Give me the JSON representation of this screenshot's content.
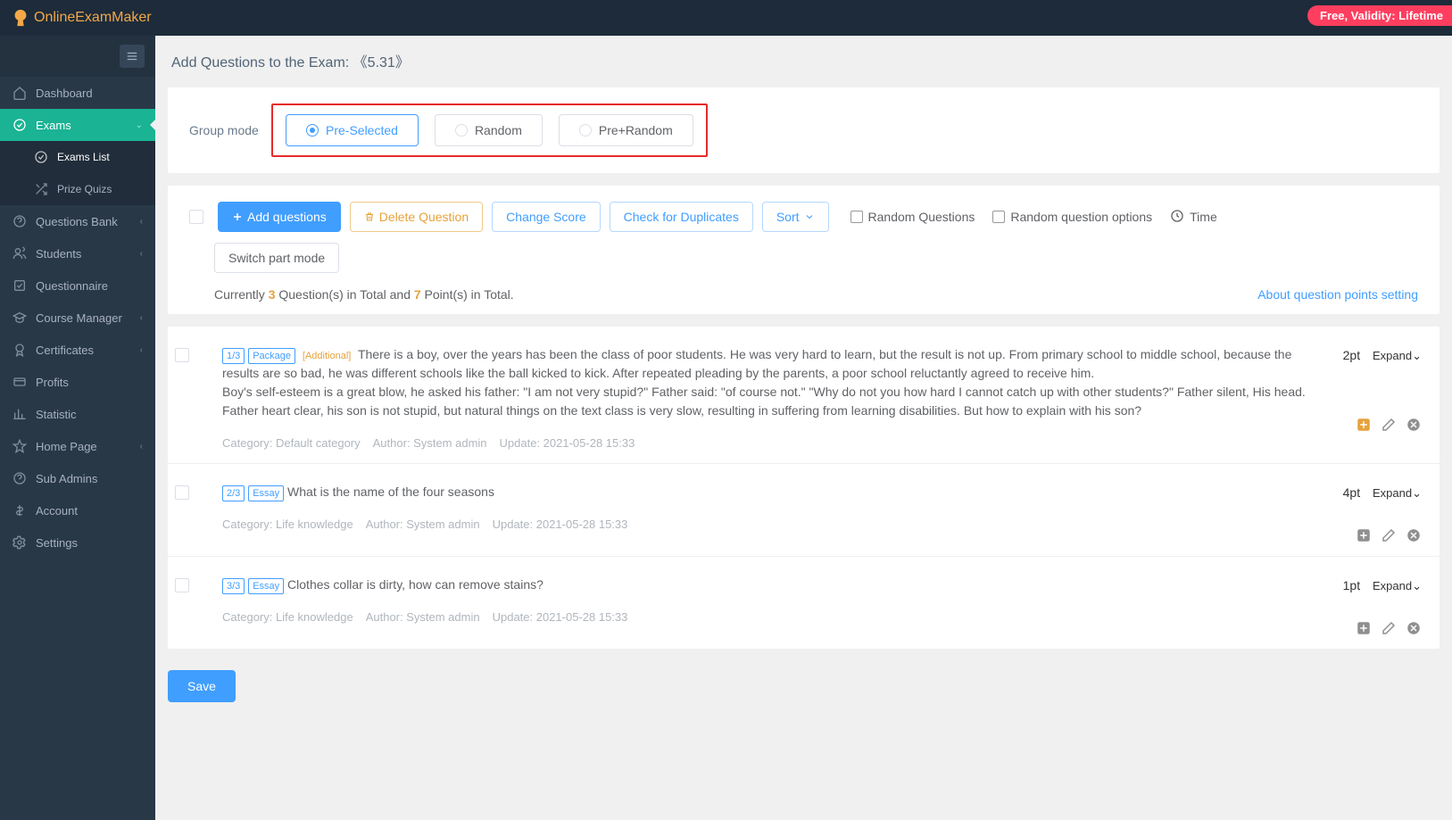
{
  "brand": "OnlineExamMaker",
  "free_badge": "Free, Validity: Lifetime",
  "sidebar": {
    "items": [
      {
        "label": "Dashboard"
      },
      {
        "label": "Exams"
      },
      {
        "label": "Questions Bank"
      },
      {
        "label": "Students"
      },
      {
        "label": "Questionnaire"
      },
      {
        "label": "Course Manager"
      },
      {
        "label": "Certificates"
      },
      {
        "label": "Profits"
      },
      {
        "label": "Statistic"
      },
      {
        "label": "Home Page"
      },
      {
        "label": "Sub Admins"
      },
      {
        "label": "Account"
      },
      {
        "label": "Settings"
      }
    ],
    "exams_sub": [
      {
        "label": "Exams List"
      },
      {
        "label": "Prize Quizs"
      }
    ]
  },
  "page": {
    "title_prefix": "Add Questions to the Exam: ",
    "exam_name": "《5.31》",
    "group_mode_label": "Group mode",
    "modes": {
      "pre": "Pre-Selected",
      "random": "Random",
      "prerandom": "Pre+Random"
    }
  },
  "toolbar": {
    "add": "Add questions",
    "delete": "Delete Question",
    "change_score": "Change Score",
    "duplicates": "Check for Duplicates",
    "sort": "Sort",
    "random_q": "Random Questions",
    "random_opt": "Random question options",
    "time": "Time",
    "switch_part": "Switch part mode"
  },
  "summary": {
    "prefix": "Currently ",
    "qcount": "3",
    "mid": " Question(s) in Total and ",
    "points": "7",
    "suffix": " Point(s) in Total.",
    "link": "About question points setting"
  },
  "questions": [
    {
      "idx": "1/3",
      "type": "Package",
      "extra": "[Additional]",
      "text": "There is a boy, over the years has been the class of poor students. He was very hard to learn, but the result is not up. From primary school to middle school, because the results are so bad, he was different schools like the ball kicked to kick. After repeated pleading by the parents, a poor school reluctantly agreed to receive him.\nBoy's self-esteem is a great blow, he asked his father: \"I am not very stupid?\" Father said: \"of course not.\" \"Why do not you how hard I cannot catch up with other students?\" Father silent, His head.\nFather heart clear, his son is not stupid, but natural things on the text class is very slow, resulting in suffering from learning disabilities. But how to explain with his son?",
      "category": "Category: Default category",
      "author": "Author: System admin",
      "update": "Update: 2021-05-28 15:33",
      "pt": "2pt",
      "expand": "Expand"
    },
    {
      "idx": "2/3",
      "type": "Essay",
      "text": "What is the name of the four seasons",
      "category": "Category: Life knowledge",
      "author": "Author: System admin",
      "update": "Update: 2021-05-28 15:33",
      "pt": "4pt",
      "expand": "Expand"
    },
    {
      "idx": "3/3",
      "type": "Essay",
      "text": "Clothes collar is dirty, how can remove stains?",
      "category": "Category: Life knowledge",
      "author": "Author: System admin",
      "update": "Update: 2021-05-28 15:33",
      "pt": "1pt",
      "expand": "Expand"
    }
  ],
  "save": "Save"
}
